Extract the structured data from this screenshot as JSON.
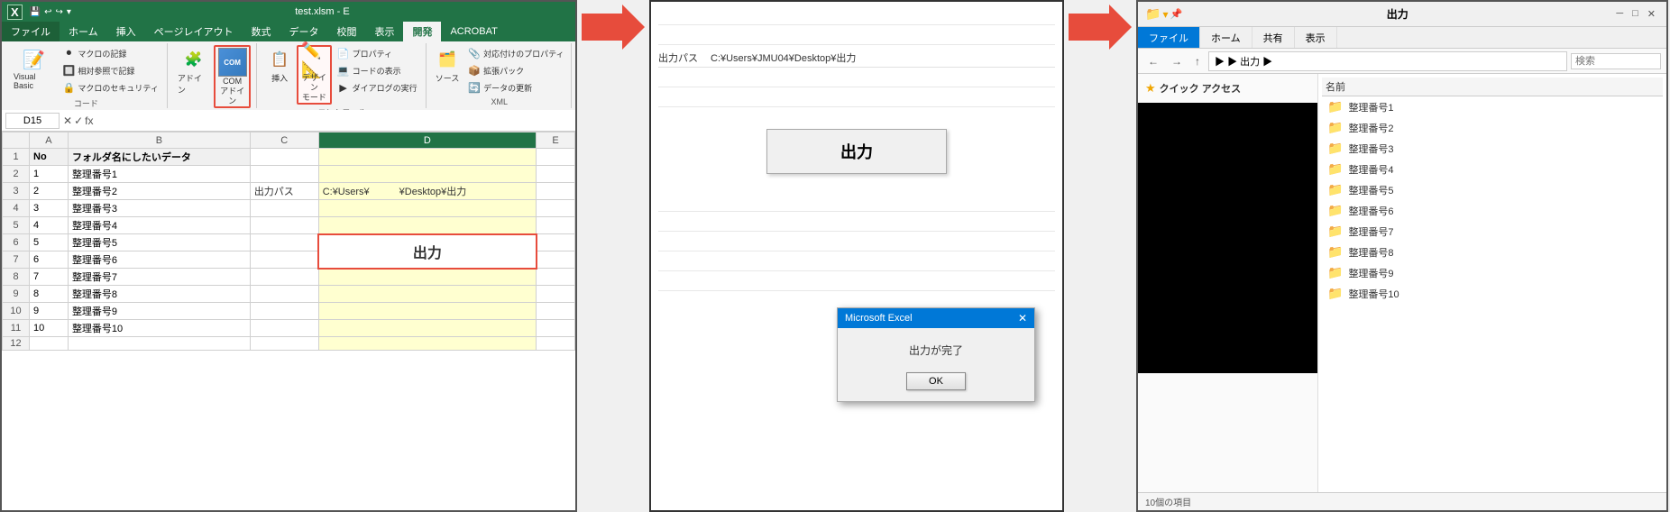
{
  "excel": {
    "title": "test.xlsm - E",
    "app_icon": "X",
    "tabs": [
      "ファイル",
      "ホーム",
      "挿入",
      "ページレイアウト",
      "数式",
      "データ",
      "校閲",
      "表示",
      "開発",
      "ACROBAT"
    ],
    "active_tab": "開発",
    "groups": {
      "code": {
        "label": "コード",
        "buttons": [
          "Visual Basic",
          "マクロ"
        ]
      },
      "adoin": {
        "label": "アドイン",
        "buttons": [
          "アドイン",
          "COMアドイン"
        ]
      },
      "controls": {
        "label": "コントロール",
        "buttons": [
          "挿入",
          "デザインモード"
        ]
      },
      "xml": {
        "label": "XML",
        "buttons": [
          "ソース"
        ]
      }
    },
    "cell_ref": "D15",
    "formula": "fx",
    "rows": [
      {
        "no": "",
        "col_a": "No",
        "col_b": "フォルダ名にしたいデータ",
        "col_c": "",
        "col_d": "",
        "col_e": ""
      },
      {
        "no": "1",
        "col_a": "1",
        "col_b": "整理番号1",
        "col_c": "",
        "col_d": "",
        "col_e": ""
      },
      {
        "no": "2",
        "col_a": "2",
        "col_b": "整理番号2",
        "col_c": "出力パス",
        "col_d": "C:¥Users¥　　　　¥Desktop¥出力",
        "col_e": ""
      },
      {
        "no": "3",
        "col_a": "3",
        "col_b": "整理番号3",
        "col_c": "",
        "col_d": "",
        "col_e": ""
      },
      {
        "no": "4",
        "col_a": "4",
        "col_b": "整理番号4",
        "col_c": "",
        "col_d": "",
        "col_e": ""
      },
      {
        "no": "5",
        "col_a": "5",
        "col_b": "整理番号5",
        "col_c": "",
        "col_d": "出力",
        "col_e": ""
      },
      {
        "no": "6",
        "col_a": "6",
        "col_b": "整理番号6",
        "col_c": "",
        "col_d": "",
        "col_e": ""
      },
      {
        "no": "7",
        "col_a": "7",
        "col_b": "整理番号7",
        "col_c": "",
        "col_d": "",
        "col_e": ""
      },
      {
        "no": "8",
        "col_a": "8",
        "col_b": "整理番号8",
        "col_c": "",
        "col_d": "",
        "col_e": ""
      },
      {
        "no": "9",
        "col_a": "9",
        "col_b": "整理番号9",
        "col_c": "",
        "col_d": "",
        "col_e": ""
      },
      {
        "no": "10",
        "col_a": "10",
        "col_b": "整理番号10",
        "col_c": "",
        "col_d": "",
        "col_e": ""
      }
    ],
    "ribbon_items": {
      "macro_record": "マクロの記録",
      "relative_ref": "相対参照で記録",
      "macro_security": "マクロのセキュリティ",
      "adoin_btn": "アドイン",
      "com_adoin": "COM\nアドイン",
      "insert_btn": "挿入",
      "design_mode": "デザイン\nモード",
      "property": "プロパティ",
      "view_code": "コードの表示",
      "run_dialog": "ダイアログの実行",
      "source": "ソース",
      "response_property": "対応付けのプロパティ",
      "extension_pack": "拡張パック",
      "data_refresh": "データの更新"
    }
  },
  "dialog": {
    "path_label": "出力パス",
    "path_value": "C:¥Users¥JMU04¥Desktop¥出力",
    "output_btn": "出力",
    "excel_dialog": {
      "title": "Microsoft Excel",
      "message": "出力が完了",
      "ok_label": "OK"
    }
  },
  "explorer": {
    "title": "出力",
    "tabs": [
      "ファイル",
      "ホーム",
      "共有",
      "表示"
    ],
    "active_tab": "ファイル",
    "address": "出力",
    "address_path": "▶ 出力 ▶",
    "col_header": "名前",
    "folders": [
      "整理番号1",
      "整理番号2",
      "整理番号3",
      "整理番号4",
      "整理番号5",
      "整理番号6",
      "整理番号7",
      "整理番号8",
      "整理番号9",
      "整理番号10"
    ],
    "quick_access_label": "クイック アクセス"
  }
}
